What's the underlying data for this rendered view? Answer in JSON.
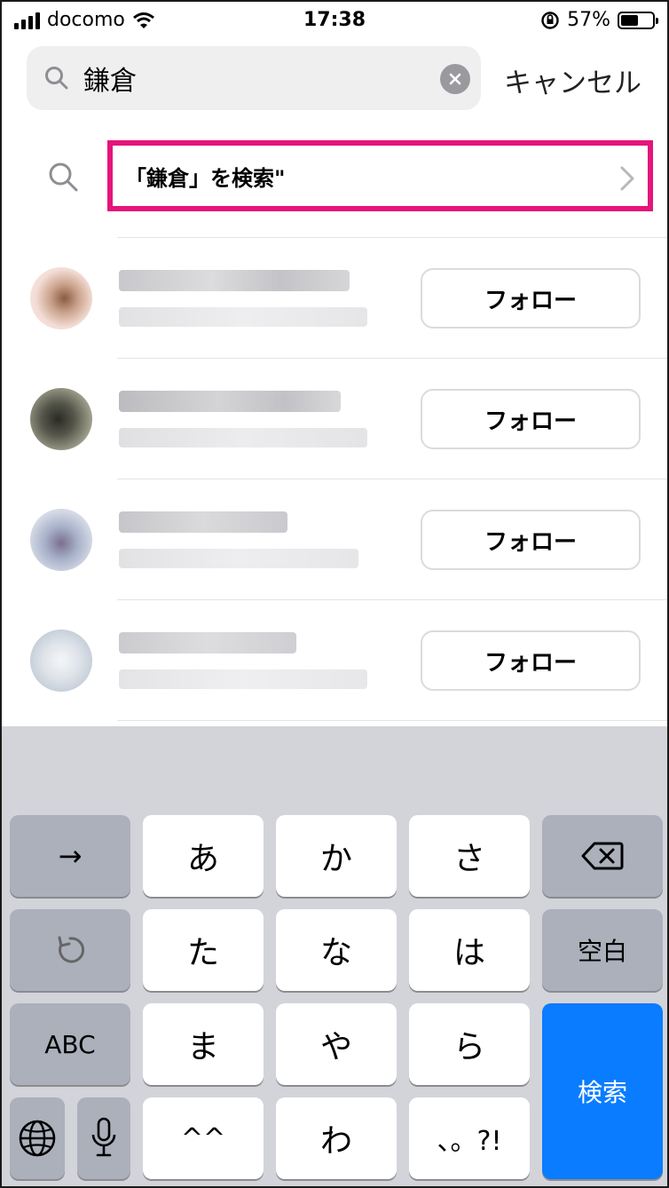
{
  "status_bar": {
    "carrier": "docomo",
    "time": "17:38",
    "battery_percent": "57%",
    "battery_level": 0.57
  },
  "search": {
    "query": "鎌倉",
    "placeholder": "",
    "cancel_label": "キャンセル"
  },
  "keyword_suggestion": {
    "label": "「鎌倉」を検索\""
  },
  "results": [
    {
      "follow_label": "フォロー"
    },
    {
      "follow_label": "フォロー"
    },
    {
      "follow_label": "フォロー"
    },
    {
      "follow_label": "フォロー"
    }
  ],
  "keyboard": {
    "arrow": "→",
    "row1": [
      "あ",
      "か",
      "さ"
    ],
    "row2": [
      "た",
      "な",
      "は"
    ],
    "row3": [
      "ま",
      "や",
      "ら"
    ],
    "row4": [
      "^^",
      "わ",
      "、。?!"
    ],
    "space_label": "空白",
    "abc_label": "ABC",
    "search_label": "検索"
  },
  "icons": [
    "signal-icon",
    "wifi-icon",
    "rotation-lock-icon",
    "battery-icon",
    "search-icon",
    "clear-icon",
    "chevron-right-icon",
    "backspace-icon",
    "undo-icon",
    "globe-icon",
    "microphone-icon"
  ],
  "colors": {
    "highlight": "#e5157a",
    "search_key": "#0a7cff",
    "keyboard_bg": "#d2d4da"
  }
}
